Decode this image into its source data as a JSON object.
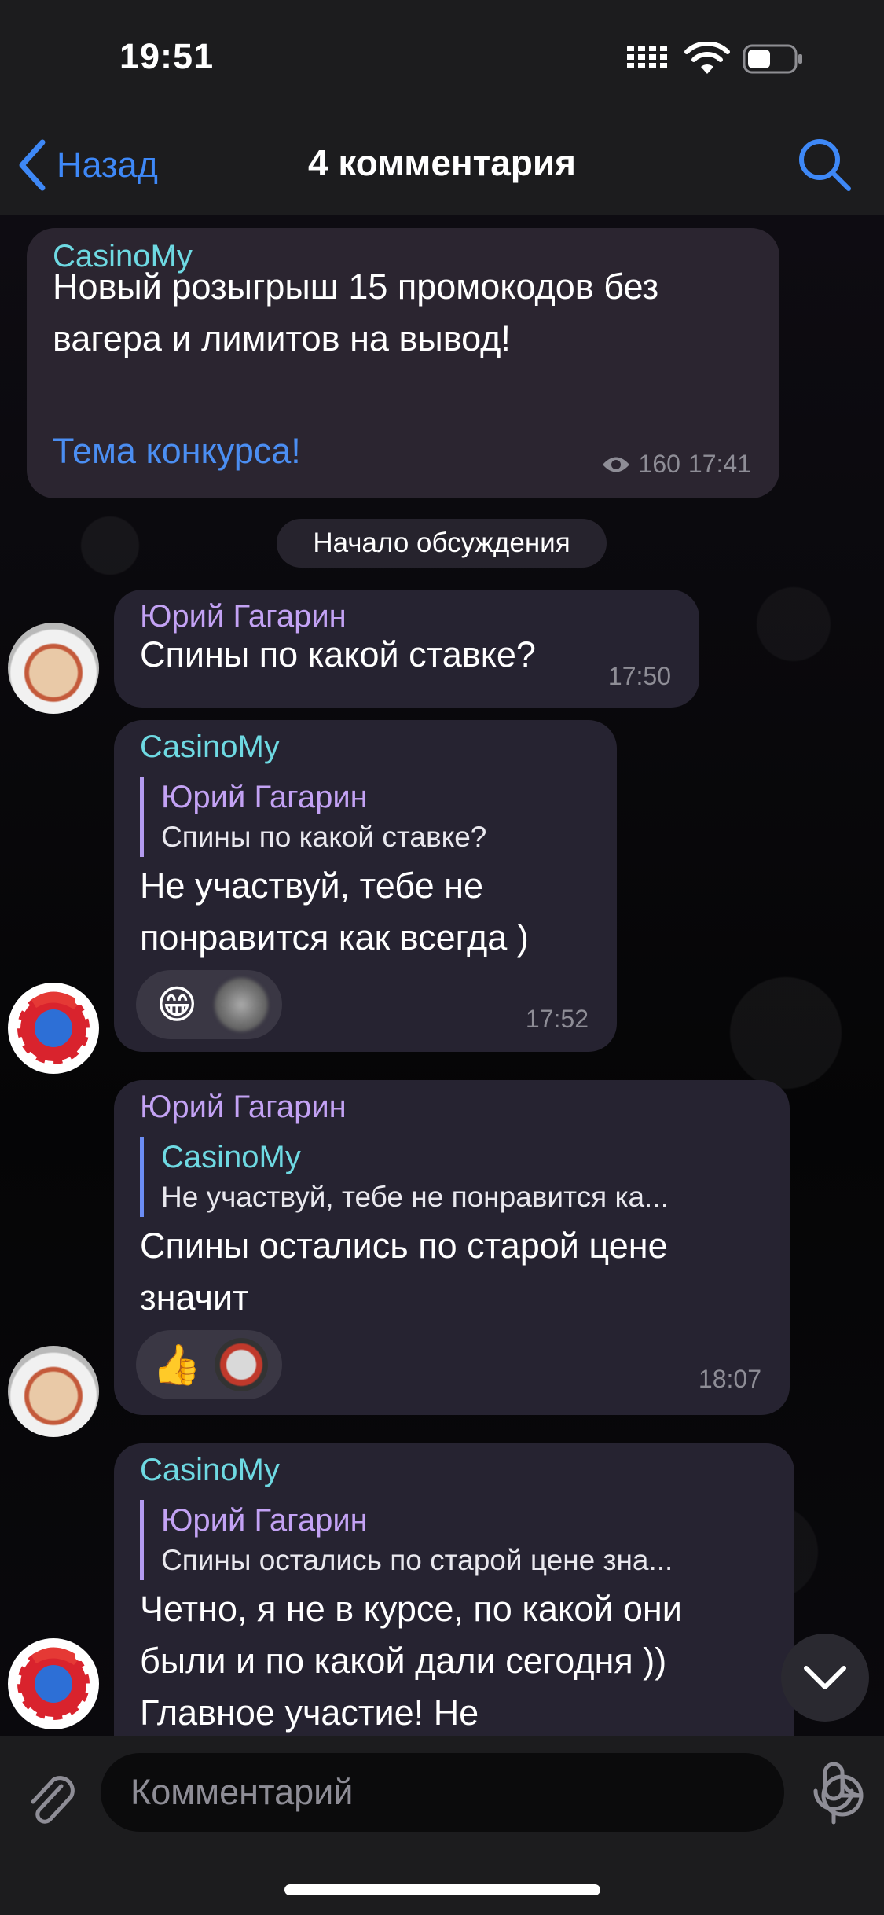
{
  "status_bar": {
    "time": "19:51"
  },
  "nav": {
    "back_label": "Назад",
    "title": "4 комментария"
  },
  "channel_post": {
    "sender": "CasinoMy",
    "text": "Новый розыгрыш 15 промокодов без вагера и лимитов на вывод!",
    "link": "Тема конкурса!",
    "views": "160",
    "time": "17:41"
  },
  "discussion_start": "Начало обсуждения",
  "messages": [
    {
      "sender": "Юрий Гагарин",
      "text": "Спины по какой ставке?",
      "time": "17:50"
    },
    {
      "sender": "CasinoMy",
      "reply_name": "Юрий Гагарин",
      "reply_text": "Спины по какой ставке?",
      "text": "Не участвуй, тебе не понравится как всегда )",
      "reactions": [
        "😁",
        "blurred-avatar"
      ],
      "time": "17:52"
    },
    {
      "sender": "Юрий Гагарин",
      "reply_name": "CasinoMy",
      "reply_text": "Не участвуй, тебе не понравится ка...",
      "text": "Спины остались по старой цене значит",
      "reactions": [
        "👍",
        "slot-machine"
      ],
      "time": "18:07"
    },
    {
      "sender": "CasinoMy",
      "reply_name": "Юрий Гагарин",
      "reply_text": "Спины остались по старой цене зна...",
      "text": "Четно, я не в курсе, по какой они были и по какой дали сегодня )) Главное участие! Не"
    }
  ],
  "input": {
    "placeholder": "Комментарий"
  },
  "colors": {
    "accent": "#3e88f7",
    "casino_name": "#6ed9e2",
    "yuri_name": "#c3a2f4"
  }
}
